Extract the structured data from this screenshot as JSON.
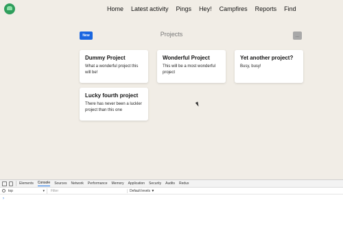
{
  "nav": {
    "items": [
      "Home",
      "Latest activity",
      "Pings",
      "Hey!",
      "Campfires",
      "Reports",
      "Find"
    ]
  },
  "header": {
    "new_label": "New",
    "title": "Projects",
    "more_label": "..."
  },
  "projects": [
    {
      "name": "Dummy Project",
      "description": "What a wonderful project this will be!"
    },
    {
      "name": "Wonderful Project",
      "description": "This will be a most wonderful project"
    },
    {
      "name": "Yet another project?",
      "description": "Busy, busy!"
    },
    {
      "name": "Lucky fourth project",
      "description": "There has never been a luckler project than this one"
    }
  ],
  "devtools": {
    "tabs": [
      "Elements",
      "Console",
      "Sources",
      "Network",
      "Performance",
      "Memory",
      "Application",
      "Security",
      "Audits",
      "Redux"
    ],
    "active_tab": "Console",
    "context": "top",
    "filter_placeholder": "Filter",
    "levels": "Default levels ▼",
    "prompt": "›"
  },
  "colors": {
    "background": "#f1ede6",
    "new_button": "#1a66e0",
    "card": "#ffffff"
  }
}
